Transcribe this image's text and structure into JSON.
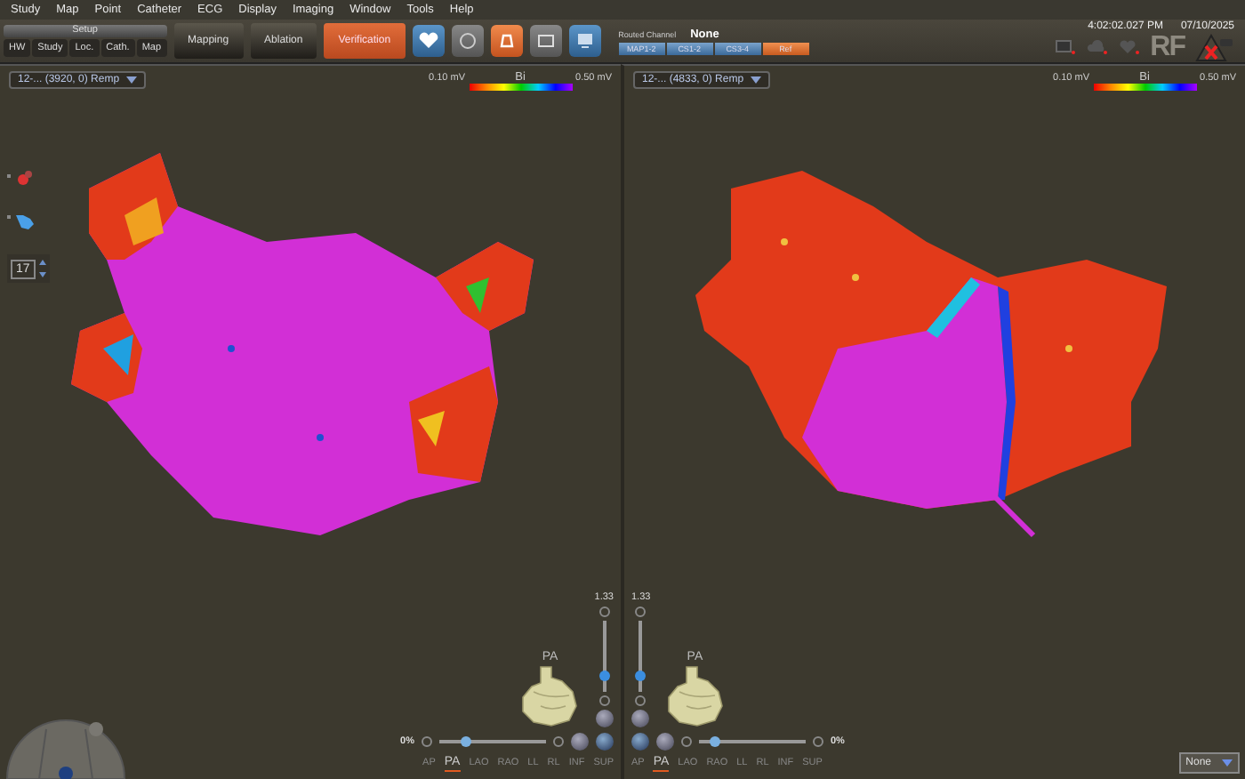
{
  "menu": [
    "Study",
    "Map",
    "Point",
    "Catheter",
    "ECG",
    "Display",
    "Imaging",
    "Window",
    "Tools",
    "Help"
  ],
  "toolbar": {
    "setup": {
      "label": "Setup",
      "steps": [
        {
          "label": "HW"
        },
        {
          "label": "Study"
        },
        {
          "label": "Loc."
        },
        {
          "label": "Cath."
        },
        {
          "label": "Map"
        }
      ]
    },
    "workflow": [
      {
        "label": "Mapping",
        "selected": false
      },
      {
        "label": "Ablation",
        "selected": false
      },
      {
        "label": "Verification",
        "selected": true
      }
    ],
    "routed_channel": {
      "label": "Routed Channel",
      "value": "None",
      "channels": [
        {
          "label": "MAP1-2",
          "selected": false
        },
        {
          "label": "CS1-2",
          "selected": false
        },
        {
          "label": "CS3-4",
          "selected": false
        },
        {
          "label": "Ref",
          "selected": true
        }
      ]
    }
  },
  "clock": {
    "time": "4:02:02.027 PM",
    "date": "07/10/2025"
  },
  "rf_indicator": {
    "label": "RF"
  },
  "left_tools": {
    "count": "17"
  },
  "panels": [
    {
      "map_name": "12-... (3920, 0) Remp",
      "scale": {
        "min": "0.10 mV",
        "type": "Bi",
        "max": "0.50 mV"
      },
      "zoom": {
        "reading": "1.33",
        "level": 0.15
      },
      "orientation": "PA",
      "opacity": {
        "reading": "0%",
        "level": 0.2
      },
      "views": [
        {
          "label": "AP",
          "selected": false
        },
        {
          "label": "PA",
          "selected": true
        },
        {
          "label": "LAO",
          "selected": false
        },
        {
          "label": "RAO",
          "selected": false
        },
        {
          "label": "LL",
          "selected": false
        },
        {
          "label": "RL",
          "selected": false
        },
        {
          "label": "INF",
          "selected": false
        },
        {
          "label": "SUP",
          "selected": false
        }
      ]
    },
    {
      "map_name": "12-... (4833, 0) Remp",
      "scale": {
        "min": "0.10 mV",
        "type": "Bi",
        "max": "0.50 mV"
      },
      "zoom": {
        "reading": "1.33",
        "level": 0.15
      },
      "orientation": "PA",
      "opacity": {
        "reading": "0%",
        "level": 0.1
      },
      "views": [
        {
          "label": "AP",
          "selected": false
        },
        {
          "label": "PA",
          "selected": true
        },
        {
          "label": "LAO",
          "selected": false
        },
        {
          "label": "RAO",
          "selected": false
        },
        {
          "label": "LL",
          "selected": false
        },
        {
          "label": "RL",
          "selected": false
        },
        {
          "label": "INF",
          "selected": false
        },
        {
          "label": "SUP",
          "selected": false
        }
      ]
    }
  ],
  "display_select": {
    "value": "None"
  }
}
